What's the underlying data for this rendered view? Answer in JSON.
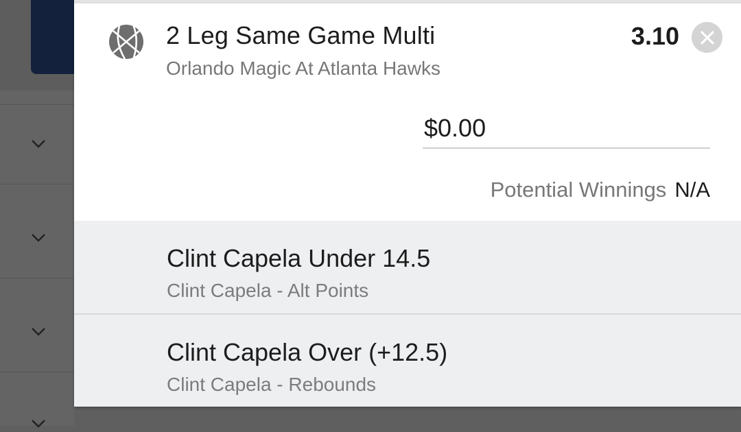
{
  "bet": {
    "icon": "basketball-icon",
    "title": "2 Leg Same Game Multi",
    "match": "Orlando Magic At Atlanta Hawks",
    "odds": "3.10",
    "stake_value": "$0.00",
    "winnings_label": "Potential Winnings",
    "winnings_value": "N/A"
  },
  "legs": [
    {
      "selection": "Clint Capela Under 14.5",
      "market": "Clint Capela - Alt Points"
    },
    {
      "selection": "Clint Capela Over (+12.5)",
      "market": "Clint Capela - Rebounds"
    }
  ],
  "colors": {
    "overlay": "#5f5f5f",
    "navy": "#14213d",
    "leg_background": "#eeeff1",
    "close_button": "#d4d4d4"
  }
}
